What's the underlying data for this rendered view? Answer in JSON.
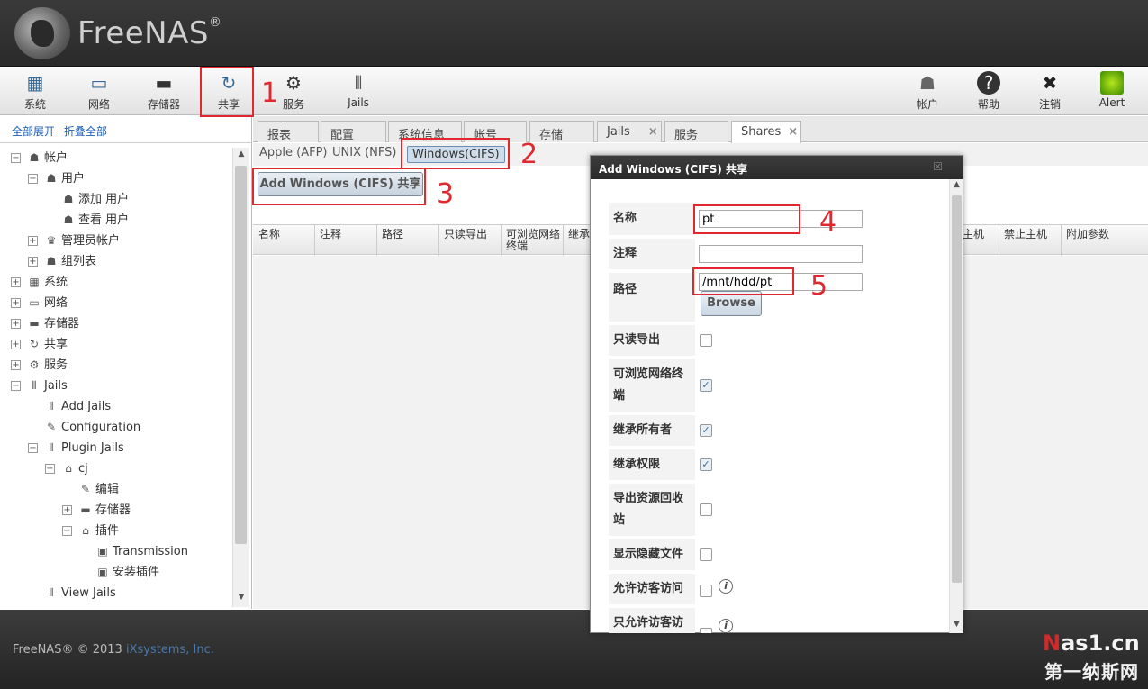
{
  "brand": {
    "name": "FreeNAS",
    "reg": "®"
  },
  "toolbar": {
    "left": [
      {
        "label": "系统",
        "icon": "system-icon"
      },
      {
        "label": "网络",
        "icon": "network-icon"
      },
      {
        "label": "存储器",
        "icon": "storage-icon"
      },
      {
        "label": "共享",
        "icon": "sharing-icon"
      },
      {
        "label": "服务",
        "icon": "services-icon"
      },
      {
        "label": "Jails",
        "icon": "jails-icon"
      }
    ],
    "right": [
      {
        "label": "帐户",
        "icon": "account-icon"
      },
      {
        "label": "帮助",
        "icon": "help-icon"
      },
      {
        "label": "注销",
        "icon": "logout-icon"
      },
      {
        "label": "Alert",
        "icon": "alert-icon"
      }
    ]
  },
  "annotations": [
    "1",
    "2",
    "3",
    "4",
    "5"
  ],
  "sidebar": {
    "expand_all": "全部展开",
    "collapse_all": "折叠全部",
    "tree": [
      {
        "label": "帐户",
        "level": 0,
        "toggle": "−"
      },
      {
        "label": "用户",
        "level": 1,
        "toggle": "−"
      },
      {
        "label": "添加 用户",
        "level": 2,
        "toggle": ""
      },
      {
        "label": "查看 用户",
        "level": 2,
        "toggle": ""
      },
      {
        "label": "管理员帐户",
        "level": 1,
        "toggle": "+"
      },
      {
        "label": "组列表",
        "level": 1,
        "toggle": "+"
      },
      {
        "label": "系统",
        "level": 0,
        "toggle": "+"
      },
      {
        "label": "网络",
        "level": 0,
        "toggle": "+"
      },
      {
        "label": "存储器",
        "level": 0,
        "toggle": "+"
      },
      {
        "label": "共享",
        "level": 0,
        "toggle": "+"
      },
      {
        "label": "服务",
        "level": 0,
        "toggle": "+"
      },
      {
        "label": "Jails",
        "level": 0,
        "toggle": "−"
      },
      {
        "label": "Add Jails",
        "level": 1,
        "toggle": ""
      },
      {
        "label": "Configuration",
        "level": 1,
        "toggle": ""
      },
      {
        "label": "Plugin Jails",
        "level": 1,
        "toggle": "−"
      },
      {
        "label": "cj",
        "level": 2,
        "toggle": "−"
      },
      {
        "label": "编辑",
        "level": 3,
        "toggle": ""
      },
      {
        "label": "存储器",
        "level": 3,
        "toggle": "+"
      },
      {
        "label": "插件",
        "level": 3,
        "toggle": "−"
      },
      {
        "label": "Transmission",
        "level": 4,
        "toggle": ""
      },
      {
        "label": "安装插件",
        "level": 4,
        "toggle": ""
      },
      {
        "label": "View Jails",
        "level": 1,
        "toggle": ""
      }
    ]
  },
  "tabs": [
    {
      "label": "报表",
      "active": false
    },
    {
      "label": "配置",
      "active": false
    },
    {
      "label": "系统信息",
      "active": false
    },
    {
      "label": "帐号",
      "active": false
    },
    {
      "label": "存储",
      "active": false
    },
    {
      "label": "Jails",
      "active": false
    },
    {
      "label": "服务",
      "active": false
    },
    {
      "label": "Shares",
      "active": true
    }
  ],
  "subtabs": [
    "Apple (AFP)",
    "UNIX (NFS)",
    "Windows(CIFS)"
  ],
  "add_button": "Add Windows (CIFS) 共享",
  "grid_columns": [
    "名称",
    "注释",
    "路径",
    "只读导出",
    "可浏览网络终端",
    "继承",
    "主机",
    "禁止主机",
    "附加参数"
  ],
  "dialog": {
    "title": "Add Windows (CIFS) 共享",
    "close": "☒",
    "fields": {
      "name_label": "名称",
      "name_value": "pt",
      "comment_label": "注释",
      "comment_value": "",
      "path_label": "路径",
      "path_value": "/mnt/hdd/pt",
      "browse": "Browse"
    },
    "checkboxes": [
      {
        "label": "只读导出",
        "checked": false
      },
      {
        "label": "可浏览网络终端",
        "checked": true
      },
      {
        "label": "继承所有者",
        "checked": true
      },
      {
        "label": "继承权限",
        "checked": true
      },
      {
        "label": "导出资源回收站",
        "checked": false
      },
      {
        "label": "显示隐藏文件",
        "checked": false
      },
      {
        "label": "允许访客访问",
        "checked": false
      },
      {
        "label": "只允许访客访",
        "checked": false
      }
    ]
  },
  "footer": {
    "copyright": "FreeNAS® © 2013",
    "company": "iXsystems, Inc."
  },
  "watermark": {
    "line1a": "N",
    "line1b": "as1.cn",
    "line2": "第一纳斯网"
  }
}
